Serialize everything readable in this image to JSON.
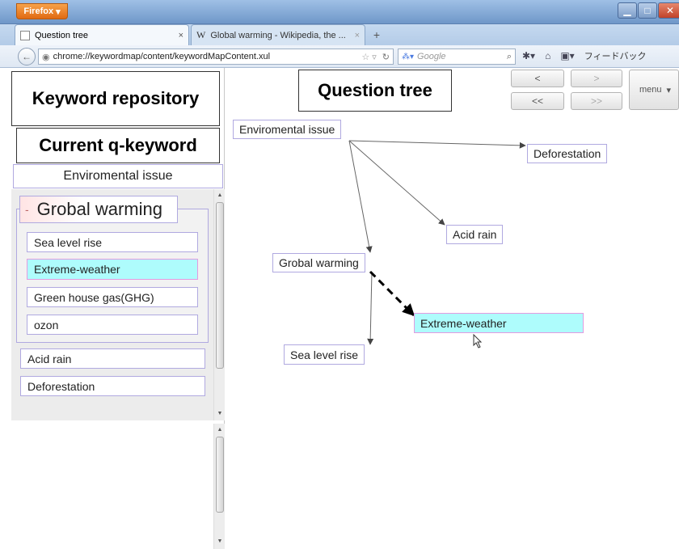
{
  "browser": {
    "app_button": "Firefox",
    "tabs": [
      {
        "label": "Question tree",
        "close": "×"
      },
      {
        "label": "Global warming - Wikipedia, the ...",
        "close": "×"
      }
    ],
    "new_tab": "+",
    "url": "chrome://keywordmap/content/keywordMapContent.xul",
    "search_placeholder": "Google",
    "feedback": "フィードバック"
  },
  "labels": {
    "keyword_repository": "Keyword repository",
    "current_q_keyword": "Current q-keyword",
    "question_tree": "Question tree"
  },
  "left_panel": {
    "current_keyword": "Enviromental issue",
    "group": {
      "toggle": "-",
      "title": "Grobal warming",
      "items": [
        "Sea level rise",
        "Extreme-weather",
        "Green house gas(GHG)",
        "ozon"
      ]
    },
    "others": [
      "Acid rain",
      "Deforestation"
    ]
  },
  "nav_buttons": {
    "prev": "<",
    "next": ">",
    "first": "<<",
    "last": ">>",
    "menu": "menu"
  },
  "tree": {
    "nodes": {
      "root": "Enviromental issue",
      "deforestation": "Deforestation",
      "acid_rain": "Acid rain",
      "global_warming": "Grobal warming",
      "extreme_weather": "Extreme-weather",
      "sea_level": "Sea level rise"
    }
  },
  "colors": {
    "highlight": "#aefcfc",
    "node_border": "#b0a9e0",
    "group_title_bg": "#ffe4e4"
  }
}
